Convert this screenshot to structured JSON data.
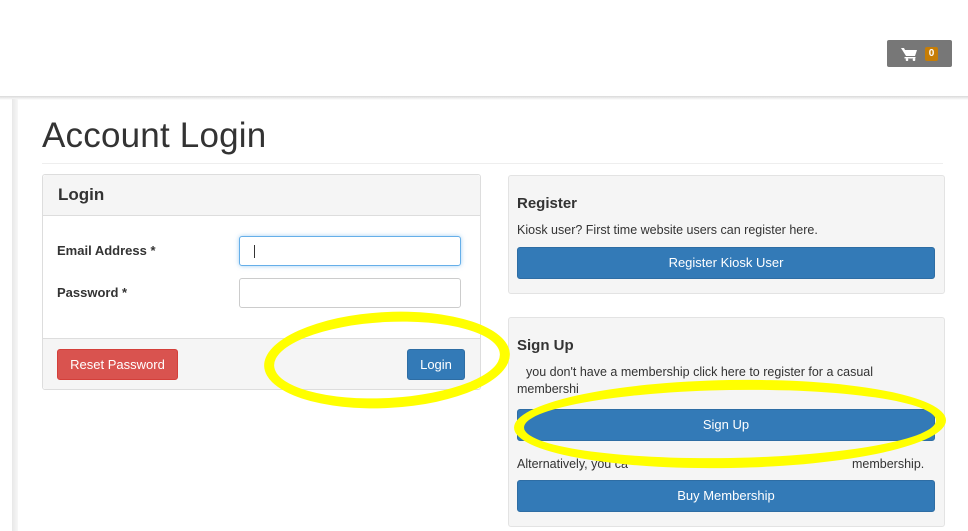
{
  "header": {
    "cart_icon": "shopping-cart-icon",
    "cart_count": "0"
  },
  "page": {
    "title": "Account Login"
  },
  "login": {
    "heading": "Login",
    "email_label": "Email Address *",
    "email_value": "",
    "password_label": "Password *",
    "password_value": "",
    "reset_label": "Reset Password",
    "login_label": "Login"
  },
  "register": {
    "heading": "Register",
    "text": "Kiosk user? First time website users can register here.",
    "button_label": "Register Kiosk User"
  },
  "signup": {
    "heading": "Sign Up",
    "text_line1": "you don't have a membership click here to register for a casual",
    "text_line2": "membershi",
    "button_label": "Sign Up",
    "alt_text_left": "Alternatively, you ca",
    "alt_text_right": "membership.",
    "buy_label": "Buy Membership"
  },
  "colors": {
    "primary": "#337ab7",
    "danger": "#d9534f",
    "cart_badge": "#c67d06",
    "highlight": "#ffff00"
  }
}
